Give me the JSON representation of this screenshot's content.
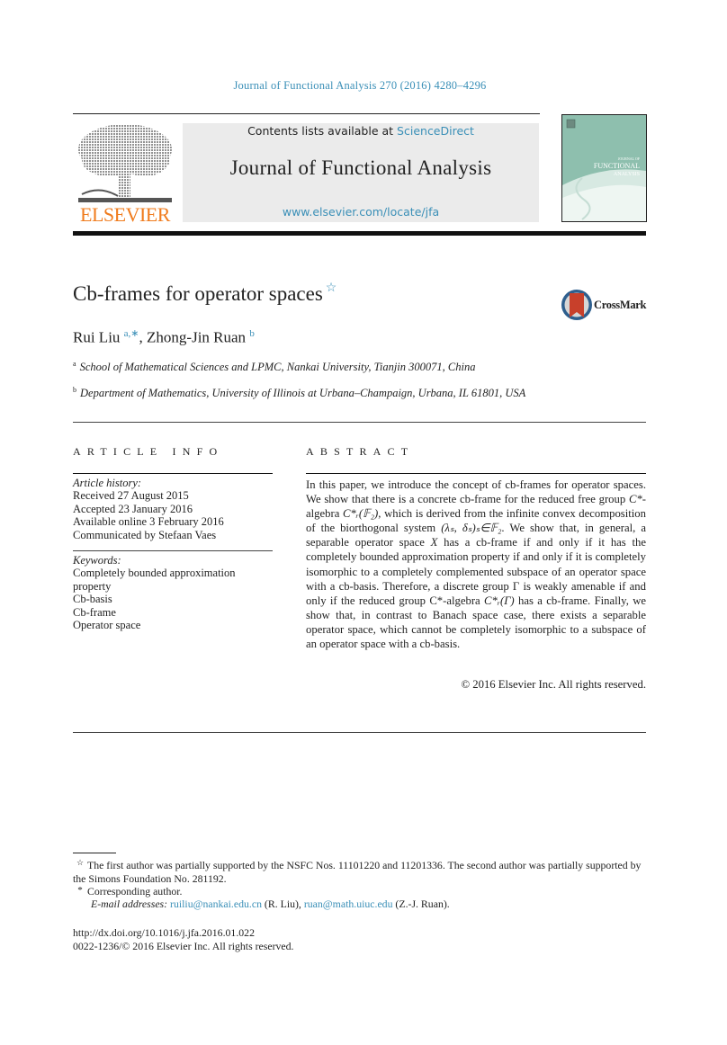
{
  "header": {
    "journal_reference": "Journal of Functional Analysis 270 (2016) 4280–4296",
    "contents_prefix": "Contents lists available at ",
    "contents_link": "ScienceDirect",
    "journal_title": "Journal of Functional Analysis",
    "journal_url": "www.elsevier.com/locate/jfa",
    "publisher_logo_text": "ELSEVIER",
    "cover": {
      "line1": "JOURNAL OF",
      "line2": "FUNCTIONAL",
      "line3": "ANALYSIS"
    },
    "colors": {
      "link": "#3a8fb7",
      "publisher_orange": "#f07c1e",
      "panel_gray": "#ebebeb",
      "cover_teal": "#8ebfae"
    }
  },
  "article": {
    "title": "Cb-frames for operator spaces",
    "title_note_mark": "☆",
    "crossmark_label": "CrossMark",
    "authors": [
      {
        "name": "Rui Liu",
        "marks": "a,∗"
      },
      {
        "name": "Zhong-Jin Ruan",
        "marks": "b"
      }
    ],
    "author_separator": ", ",
    "affiliations": [
      {
        "mark": "a",
        "text": "School of Mathematical Sciences and LPMC, Nankai University, Tianjin 300071, China"
      },
      {
        "mark": "b",
        "text": "Department of Mathematics, University of Illinois at Urbana–Champaign, Urbana, IL 61801, USA"
      }
    ]
  },
  "article_info": {
    "heading": "ARTICLE INFO",
    "history_label": "Article history:",
    "history": [
      "Received 27 August 2015",
      "Accepted 23 January 2016",
      "Available online 3 February 2016",
      "Communicated by Stefaan Vaes"
    ],
    "keywords_label": "Keywords:",
    "keywords": [
      "Completely bounded approximation property",
      "Cb-basis",
      "Cb-frame",
      "Operator space"
    ]
  },
  "abstract": {
    "heading": "ABSTRACT",
    "parts": [
      "In this paper, we introduce the concept of cb-frames for operator spaces. We show that there is a concrete cb-frame for the reduced free group ",
      "C*",
      "-algebra ",
      "C*ᵣ(𝔽₂)",
      ", which is derived from the infinite convex decomposition of the biorthogonal system ",
      "(λₛ, δₛ)ₛ∈𝔽₂",
      ". We show that, in general, a separable operator space ",
      "X",
      " has a cb-frame if and only if it has the completely bounded approximation property if and only if it is completely isomorphic to a completely complemented subspace of an operator space with a cb-basis. Therefore, a discrete group Γ is weakly amenable if and only if the reduced group C*-algebra ",
      "C*ᵣ(Γ)",
      " has a cb-frame. Finally, we show that, in contrast to Banach space case, there exists a separable operator space, which cannot be completely isomorphic to a subspace of an operator space with a cb-basis."
    ],
    "copyright": "© 2016 Elsevier Inc. All rights reserved."
  },
  "footnotes": {
    "funding_mark": "☆",
    "funding": "The first author was partially supported by the NSFC Nos. 11101220 and 11201336. The second author was partially supported by the Simons Foundation No. 281192.",
    "corresponding_mark": "*",
    "corresponding": "Corresponding author.",
    "email_label": "E-mail addresses: ",
    "emails": [
      {
        "address": "ruiliu@nankai.edu.cn",
        "owner": " (R. Liu), "
      },
      {
        "address": "ruan@math.uiuc.edu",
        "owner": " (Z.-J. Ruan)."
      }
    ],
    "doi": "http://dx.doi.org/10.1016/j.jfa.2016.01.022",
    "issn_line": "0022-1236/© 2016 Elsevier Inc. All rights reserved."
  }
}
